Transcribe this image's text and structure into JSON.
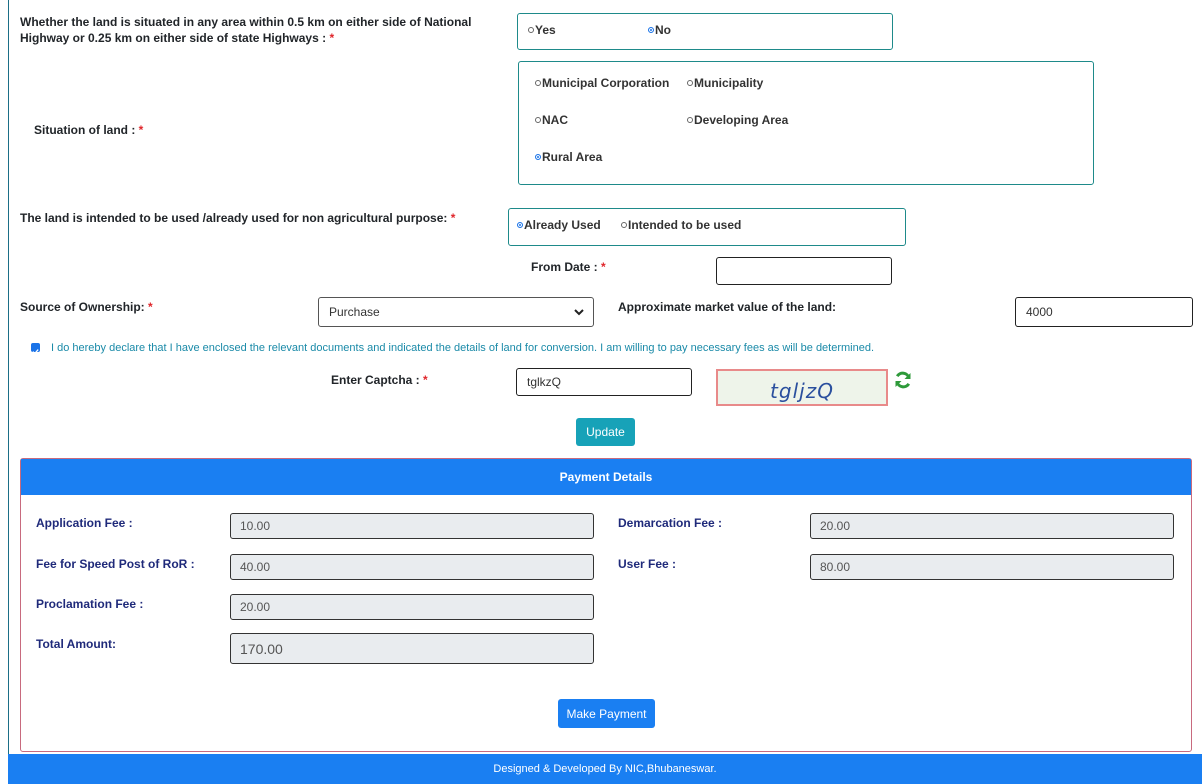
{
  "highway": {
    "label": "Whether the land is situated in any area within 0.5 km on either side of National Highway or 0.25 km on either side of state Highways :",
    "req": "*",
    "options": [
      "Yes",
      "No"
    ]
  },
  "situation": {
    "label": "Situation of land :",
    "req": "*",
    "options": [
      "Municipal Corporation",
      "Municipality",
      "NAC",
      "Developing Area",
      "Rural Area"
    ]
  },
  "usage": {
    "label": "The land is intended to be used /already used for non agricultural purpose:",
    "req": "*",
    "options": [
      "Already Used",
      "Intended to be used"
    ]
  },
  "from_date": {
    "label": "From Date :",
    "req": "*",
    "value": ""
  },
  "ownership": {
    "label": "Source of Ownership:",
    "req": "*",
    "value": "Purchase"
  },
  "market_value": {
    "label": "Approximate market value of the land:",
    "value": "4000"
  },
  "declaration": {
    "checked": true,
    "text": "I do hereby declare that I have enclosed the relevant documents and indicated the details of land for conversion. I am willing to pay necessary fees as will be determined."
  },
  "captcha": {
    "label": "Enter Captcha :",
    "req": "*",
    "value": "tglkzQ",
    "image_text": "tgljzQ"
  },
  "update_label": "Update",
  "payment": {
    "title": "Payment Details",
    "application_fee_label": "Application Fee :",
    "application_fee": "10.00",
    "demarcation_fee_label": "Demarcation Fee :",
    "demarcation_fee": "20.00",
    "speed_post_label": "Fee for Speed Post of RoR :",
    "speed_post_fee": "40.00",
    "user_fee_label": "User Fee :",
    "user_fee": "80.00",
    "proclamation_label": "Proclamation Fee :",
    "proclamation_fee": "20.00",
    "total_label": "Total Amount:",
    "total": "170.00",
    "pay_button": "Make Payment"
  },
  "footer": "Designed & Developed By NIC,Bhubaneswar.",
  "colors": {
    "primary": "#1a7ff2",
    "teal": "#17a2b8",
    "required": "#e0262b",
    "label_navy": "#1f2a7a"
  }
}
